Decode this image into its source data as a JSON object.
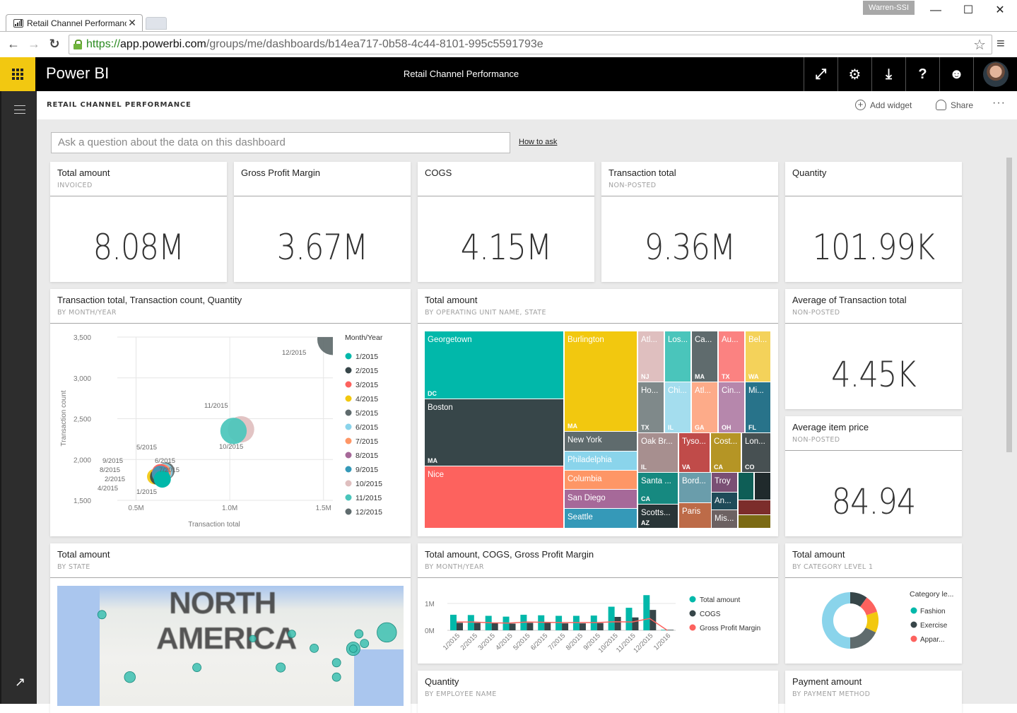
{
  "browser": {
    "tab_title": "Retail Channel Performanc",
    "tab_close": "✕",
    "user_badge": "Warren-SSI",
    "window_controls": {
      "minimize": "—",
      "maximize": "☐",
      "close": "✕"
    },
    "nav": {
      "back": "←",
      "forward": "→",
      "reload": "↻"
    },
    "url": {
      "scheme": "https://",
      "host": "app.powerbi.com",
      "path": "/groups/me/dashboards/b14ea717-0b58-4c44-8101-995c5591793e"
    },
    "star": "☆",
    "menu": "≡"
  },
  "header": {
    "brand": "Power BI",
    "title": "Retail Channel Performance",
    "icons": [
      {
        "name": "fullscreen-icon",
        "glyph": "⤢"
      },
      {
        "name": "gear-icon",
        "glyph": "⚙"
      },
      {
        "name": "download-icon",
        "glyph": "⤓"
      },
      {
        "name": "help-icon",
        "glyph": "?"
      },
      {
        "name": "smiley-icon",
        "glyph": "☻"
      }
    ]
  },
  "leftnav": {
    "expand_glyph": "↗"
  },
  "subheader": {
    "dashboard_name": "RETAIL CHANNEL PERFORMANCE",
    "add_widget": "Add widget",
    "add_widget_glyph": "+",
    "share": "Share",
    "more": "···"
  },
  "qa": {
    "placeholder": "Ask a question about the data on this dashboard",
    "how_to_ask": "How to ask"
  },
  "colors": {
    "accent": "#F2C811",
    "header_bg": "#000000",
    "nav_bg": "#2D2D2D",
    "canvas_bg": "#EAEAEA"
  },
  "kpis": [
    {
      "title": "Total amount",
      "subtitle": "INVOICED",
      "value": "8.08M"
    },
    {
      "title": "Gross Profit Margin",
      "subtitle": "",
      "value": "3.67M"
    },
    {
      "title": "COGS",
      "subtitle": "",
      "value": "4.15M"
    },
    {
      "title": "Transaction total",
      "subtitle": "NON-POSTED",
      "value": "9.36M"
    },
    {
      "title": "Quantity",
      "subtitle": "",
      "value": "101.99K"
    },
    {
      "title": "Average of Transaction total",
      "subtitle": "NON-POSTED",
      "value": "4.45K"
    },
    {
      "title": "Average item price",
      "subtitle": "NON-POSTED",
      "value": "84.94"
    }
  ],
  "tiles": {
    "scatter": {
      "title": "Transaction total, Transaction count, Quantity",
      "subtitle": "BY MONTH/YEAR"
    },
    "treemap": {
      "title": "Total amount",
      "subtitle": "BY OPERATING UNIT NAME, STATE"
    },
    "map": {
      "title": "Total amount",
      "subtitle": "BY STATE",
      "label_line1": "NORTH",
      "label_line2": "AMERICA"
    },
    "combo": {
      "title": "Total amount, COGS, Gross Profit Margin",
      "subtitle": "BY MONTH/YEAR"
    },
    "donut": {
      "title": "Total amount",
      "subtitle": "BY CATEGORY LEVEL 1"
    },
    "quantity_emp": {
      "title": "Quantity",
      "subtitle": "BY EMPLOYEE NAME"
    },
    "payment": {
      "title": "Payment amount",
      "subtitle": "BY PAYMENT METHOD"
    }
  },
  "chart_data": [
    {
      "type": "scatter",
      "title": "Transaction total, Transaction count, Quantity",
      "xlabel": "Transaction total",
      "ylabel": "Transaction count",
      "xlim": [
        0.4,
        1.55
      ],
      "ylim": [
        1500,
        3500
      ],
      "xticks": [
        "0.5M",
        "1.0M",
        "1.5M"
      ],
      "xtick_values": [
        0.5,
        1.0,
        1.5
      ],
      "yticks": [
        "1,500",
        "2,000",
        "2,500",
        "3,000",
        "3,500"
      ],
      "ytick_values": [
        1500,
        2000,
        2500,
        3000,
        3500
      ],
      "legend_title": "Month/Year",
      "legend_position": "right",
      "grid": true,
      "points": [
        {
          "label": "1/2015",
          "x": 0.64,
          "y": 1760,
          "size": 0.55,
          "color": "#01B8AA"
        },
        {
          "label": "2/2015",
          "x": 0.62,
          "y": 1790,
          "size": 0.55,
          "color": "#374649"
        },
        {
          "label": "3/2015",
          "x": 0.63,
          "y": 1840,
          "size": 0.55,
          "color": "#FD625E"
        },
        {
          "label": "4/2015",
          "x": 0.6,
          "y": 1790,
          "size": 0.5,
          "color": "#F2C80F"
        },
        {
          "label": "5/2015",
          "x": 0.66,
          "y": 1860,
          "size": 0.55,
          "color": "#5F6B6D"
        },
        {
          "label": "6/2015",
          "x": 0.65,
          "y": 1850,
          "size": 0.55,
          "color": "#8AD4EB"
        },
        {
          "label": "7/2015",
          "x": 0.64,
          "y": 1840,
          "size": 0.55,
          "color": "#FE9666"
        },
        {
          "label": "8/2015",
          "x": 0.63,
          "y": 1830,
          "size": 0.55,
          "color": "#A66999"
        },
        {
          "label": "9/2015",
          "x": 0.63,
          "y": 1820,
          "size": 0.55,
          "color": "#3599B8"
        },
        {
          "label": "10/2015",
          "x": 1.06,
          "y": 2370,
          "size": 0.85,
          "color": "#DFBFBF"
        },
        {
          "label": "11/2015",
          "x": 1.02,
          "y": 2350,
          "size": 0.85,
          "color": "#4AC5BB"
        },
        {
          "label": "12/2015",
          "x": 1.55,
          "y": 3470,
          "size": 1.0,
          "color": "#5F6B6D"
        }
      ]
    },
    {
      "type": "treemap",
      "title": "Total amount by Operating unit name, State",
      "items": [
        {
          "name": "Georgetown",
          "state": "DC",
          "color": "#01B8AA"
        },
        {
          "name": "Boston",
          "state": "MA",
          "color": "#374649"
        },
        {
          "name": "Nice",
          "state": "",
          "color": "#FD625E"
        },
        {
          "name": "Burlington",
          "state": "MA",
          "color": "#F2C80F"
        },
        {
          "name": "New York",
          "state": "",
          "color": "#5F6B6D"
        },
        {
          "name": "Philadelphia",
          "state": "",
          "color": "#8AD4EB"
        },
        {
          "name": "Columbia",
          "state": "",
          "color": "#FE9666"
        },
        {
          "name": "San Diego",
          "state": "",
          "color": "#A66999"
        },
        {
          "name": "Seattle",
          "state": "",
          "color": "#3599B8"
        },
        {
          "name": "Atl...",
          "state": "NJ",
          "color": "#DFBFBF"
        },
        {
          "name": "Los...",
          "state": "",
          "color": "#4AC5BB"
        },
        {
          "name": "Ca...",
          "state": "MA",
          "color": "#5F6B6D"
        },
        {
          "name": "Au...",
          "state": "TX",
          "color": "#FB8281"
        },
        {
          "name": "Bel...",
          "state": "WA",
          "color": "#F4D25A"
        },
        {
          "name": "Ho...",
          "state": "TX",
          "color": "#7F898A"
        },
        {
          "name": "Chi...",
          "state": "IL",
          "color": "#A4DDEE"
        },
        {
          "name": "Atl...",
          "state": "GA",
          "color": "#FDAB89"
        },
        {
          "name": "Cin...",
          "state": "OH",
          "color": "#B687AC"
        },
        {
          "name": "Mi...",
          "state": "FL",
          "color": "#28738A"
        },
        {
          "name": "Oak Br...",
          "state": "IL",
          "color": "#A78F8F"
        },
        {
          "name": "Tyso...",
          "state": "VA",
          "color": "#C04B49"
        },
        {
          "name": "Cost...",
          "state": "CA",
          "color": "#B59525"
        },
        {
          "name": "Lon...",
          "state": "CO",
          "color": "#475052"
        },
        {
          "name": "Santa ...",
          "state": "CA",
          "color": "#168980"
        },
        {
          "name": "Scotts...",
          "state": "AZ",
          "color": "#293537"
        },
        {
          "name": "Bord...",
          "state": "",
          "color": "#6A9DAB"
        },
        {
          "name": "Paris",
          "state": "",
          "color": "#BD6B48"
        },
        {
          "name": "Troy",
          "state": "",
          "color": "#7A4F74"
        },
        {
          "name": "An...",
          "state": "",
          "color": "#1F4B59"
        },
        {
          "name": "Mis...",
          "state": "",
          "color": "#6D6262"
        },
        {
          "name": "",
          "state": "",
          "color": "#0E5E56"
        },
        {
          "name": "",
          "state": "",
          "color": "#202A2C"
        },
        {
          "name": "",
          "state": "",
          "color": "#7C2D2B"
        },
        {
          "name": "",
          "state": "",
          "color": "#7B6A14"
        }
      ]
    },
    {
      "type": "bar",
      "title": "Total amount, COGS, Gross Profit Margin",
      "categories": [
        "1/2015",
        "2/2015",
        "3/2015",
        "4/2015",
        "5/2015",
        "6/2015",
        "7/2015",
        "8/2015",
        "9/2015",
        "10/2015",
        "11/2015",
        "12/2015",
        "1/2016"
      ],
      "series": [
        {
          "name": "Total amount",
          "kind": "bar",
          "color": "#01B8AA",
          "values": [
            0.58,
            0.57,
            0.54,
            0.51,
            0.58,
            0.56,
            0.54,
            0.54,
            0.55,
            0.88,
            0.84,
            1.31,
            0.02
          ]
        },
        {
          "name": "COGS",
          "kind": "bar",
          "color": "#374649",
          "values": [
            0.28,
            0.28,
            0.27,
            0.25,
            0.28,
            0.28,
            0.26,
            0.26,
            0.27,
            0.5,
            0.48,
            0.76,
            0.02
          ]
        },
        {
          "name": "Gross Profit Margin",
          "kind": "line",
          "color": "#FD625E",
          "values": [
            0.31,
            0.31,
            0.28,
            0.27,
            0.31,
            0.3,
            0.29,
            0.29,
            0.29,
            0.32,
            0.31,
            0.44,
            0.0
          ]
        }
      ],
      "yticks": [
        "0M",
        "1M"
      ],
      "ytick_values": [
        0,
        1
      ],
      "ylim": [
        0,
        1.4
      ],
      "legend_position": "right"
    },
    {
      "type": "pie",
      "title": "Total amount by Category level 1",
      "legend_title": "Category le...",
      "legend": [
        {
          "name": "Fashion",
          "color": "#01B8AA"
        },
        {
          "name": "Exercise",
          "color": "#374649"
        },
        {
          "name": "Appar...",
          "color": "#FD625E"
        }
      ],
      "slices": [
        {
          "value": 0.1,
          "color": "#374649"
        },
        {
          "value": 0.1,
          "color": "#FD625E"
        },
        {
          "value": 0.12,
          "color": "#F2C80F"
        },
        {
          "value": 0.18,
          "color": "#5F6B6D"
        },
        {
          "value": 0.5,
          "color": "#8AD4EB"
        }
      ]
    },
    {
      "type": "scatter",
      "title": "Total amount by State (map)",
      "bubbles": [
        {
          "lon": -122,
          "lat": 46,
          "size": 1
        },
        {
          "lon": -117,
          "lat": 33,
          "size": 1.3
        },
        {
          "lon": -105,
          "lat": 35,
          "size": 1
        },
        {
          "lon": -95,
          "lat": 41,
          "size": 0.8
        },
        {
          "lon": -88,
          "lat": 42,
          "size": 0.9
        },
        {
          "lon": -90,
          "lat": 35,
          "size": 1.1
        },
        {
          "lon": -84,
          "lat": 39,
          "size": 1
        },
        {
          "lon": -80,
          "lat": 36,
          "size": 1
        },
        {
          "lon": -77,
          "lat": 38.9,
          "size": 1.6
        },
        {
          "lon": -77,
          "lat": 38.9,
          "size": 0.9
        },
        {
          "lon": -76,
          "lat": 42,
          "size": 1
        },
        {
          "lon": -75,
          "lat": 40,
          "size": 1
        },
        {
          "lon": -71,
          "lat": 42.3,
          "size": 2.3
        },
        {
          "lon": -80,
          "lat": 33,
          "size": 1
        }
      ]
    }
  ]
}
